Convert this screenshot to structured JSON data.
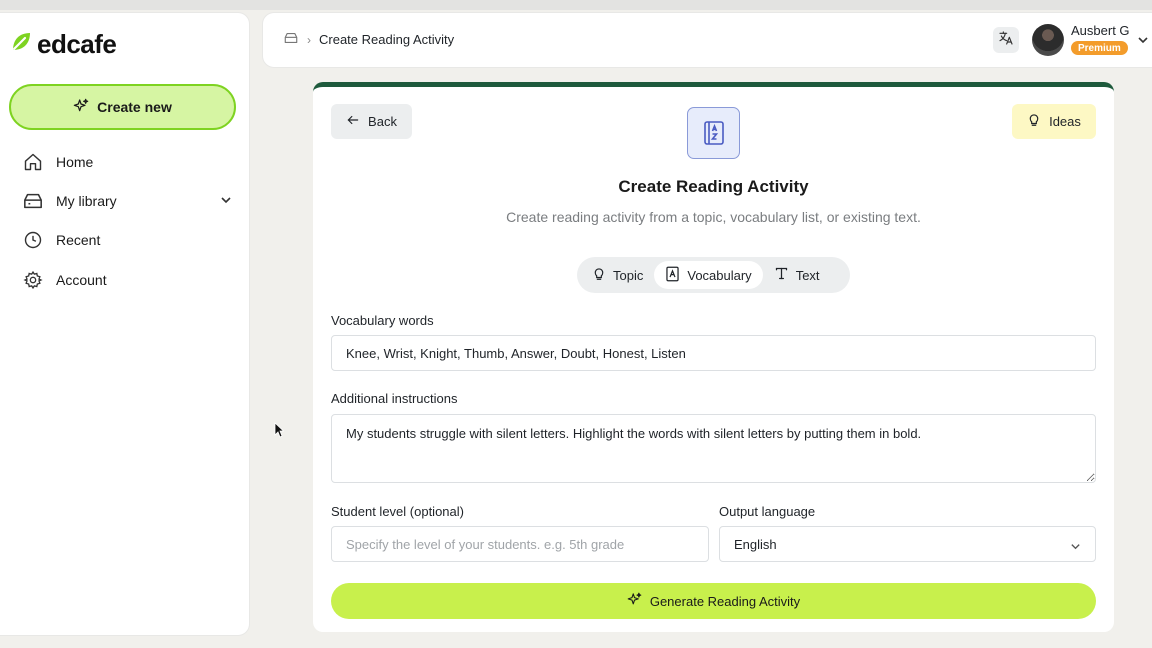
{
  "app": {
    "name": "edcafe",
    "brand_color": "#7ed321"
  },
  "sidebar": {
    "create_label": "Create new",
    "items": [
      {
        "label": "Home",
        "icon": "home-icon"
      },
      {
        "label": "My library",
        "icon": "library-icon"
      },
      {
        "label": "Recent",
        "icon": "clock-icon"
      },
      {
        "label": "Account",
        "icon": "gear-icon"
      }
    ]
  },
  "header": {
    "breadcrumb": "Create Reading Activity",
    "user_name": "Ausbert G",
    "badge": "Premium"
  },
  "main": {
    "back_label": "Back",
    "ideas_label": "Ideas",
    "title": "Create Reading Activity",
    "subtitle": "Create reading activity from a topic, vocabulary list, or existing text.",
    "tabs": [
      {
        "label": "Topic",
        "icon": "lightbulb-icon"
      },
      {
        "label": "Vocabulary",
        "icon": "vocabulary-icon",
        "active": true
      },
      {
        "label": "Text",
        "icon": "text-icon"
      }
    ],
    "vocab_label": "Vocabulary words",
    "vocab_value": "Knee, Wrist, Knight, Thumb, Answer, Doubt, Honest, Listen",
    "instructions_label": "Additional instructions",
    "instructions_value": "My students struggle with silent letters. Highlight the words with silent letters by putting them in bold.",
    "level_label": "Student level (optional)",
    "level_placeholder": "Specify the level of your students. e.g. 5th grade",
    "language_label": "Output language",
    "language_value": "English",
    "generate_label": "Generate Reading Activity"
  }
}
